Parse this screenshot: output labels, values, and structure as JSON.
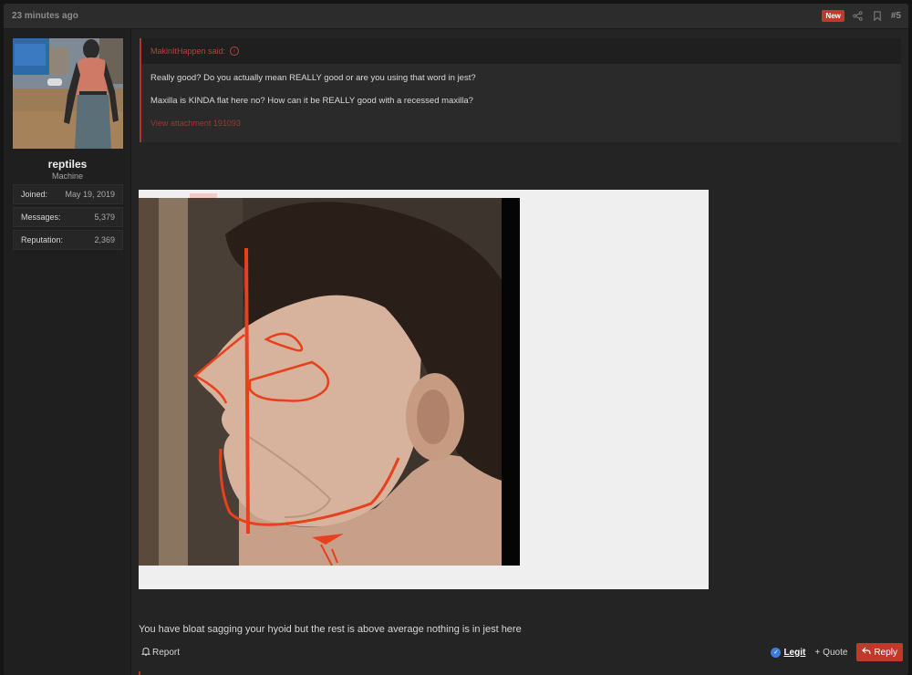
{
  "post": {
    "time": "23 minutes ago",
    "badge": "New",
    "number": "#5",
    "icons": [
      "share-icon",
      "bookmark-icon"
    ]
  },
  "user": {
    "name": "reptiles",
    "title": "Machine",
    "stats": [
      {
        "label": "Joined:",
        "value": "May 19, 2019"
      },
      {
        "label": "Messages:",
        "value": "5,379"
      },
      {
        "label": "Reputation:",
        "value": "2,369"
      }
    ]
  },
  "quote": {
    "author": "MakinItHappen said:",
    "lines": [
      "Really good? Do you actually mean REALLY good or are you using that word in jest?",
      "Maxilla is KINDA flat here no? How can it be REALLY good with a recessed maxilla?"
    ],
    "link": "View attachment 191093"
  },
  "body_text": "You have bloat sagging your hyoid but the rest is above average nothing is in jest here",
  "actions": {
    "report": "Report",
    "legit": "Legit",
    "quote": "Quote",
    "reply": "Reply"
  },
  "colors": {
    "accent": "#c0392b",
    "background": "#242424",
    "sidebar": "#1f1f1f",
    "annotation": "#e8401c"
  }
}
